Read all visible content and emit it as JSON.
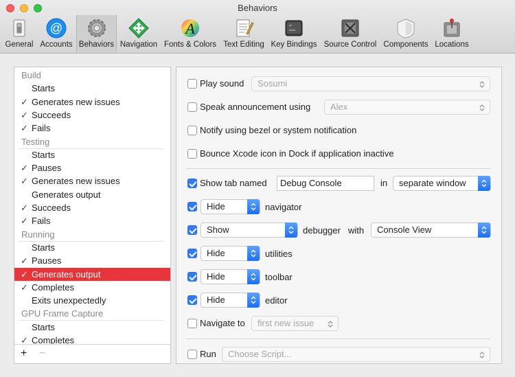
{
  "window": {
    "title": "Behaviors"
  },
  "toolbar": {
    "items": [
      {
        "label": "General",
        "icon": "general-icon"
      },
      {
        "label": "Accounts",
        "icon": "accounts-icon"
      },
      {
        "label": "Behaviors",
        "icon": "behaviors-gear-icon",
        "active": true
      },
      {
        "label": "Navigation",
        "icon": "navigation-icon"
      },
      {
        "label": "Fonts & Colors",
        "icon": "fonts-colors-icon"
      },
      {
        "label": "Text Editing",
        "icon": "text-editing-icon"
      },
      {
        "label": "Key Bindings",
        "icon": "key-bindings-icon"
      },
      {
        "label": "Source Control",
        "icon": "source-control-icon"
      },
      {
        "label": "Components",
        "icon": "components-icon"
      },
      {
        "label": "Locations",
        "icon": "locations-icon"
      }
    ]
  },
  "list": {
    "rows": [
      {
        "type": "header",
        "label": "Build"
      },
      {
        "type": "item",
        "label": "Starts",
        "checked": false
      },
      {
        "type": "item",
        "label": "Generates new issues",
        "checked": true
      },
      {
        "type": "item",
        "label": "Succeeds",
        "checked": true
      },
      {
        "type": "item",
        "label": "Fails",
        "checked": true
      },
      {
        "type": "header",
        "label": "Testing"
      },
      {
        "type": "item",
        "label": "Starts",
        "checked": false
      },
      {
        "type": "item",
        "label": "Pauses",
        "checked": true
      },
      {
        "type": "item",
        "label": "Generates new issues",
        "checked": true
      },
      {
        "type": "item",
        "label": "Generates output",
        "checked": false
      },
      {
        "type": "item",
        "label": "Succeeds",
        "checked": true
      },
      {
        "type": "item",
        "label": "Fails",
        "checked": true
      },
      {
        "type": "header",
        "label": "Running"
      },
      {
        "type": "item",
        "label": "Starts",
        "checked": false
      },
      {
        "type": "item",
        "label": "Pauses",
        "checked": true
      },
      {
        "type": "item",
        "label": "Generates output",
        "checked": true,
        "selected": true
      },
      {
        "type": "item",
        "label": "Completes",
        "checked": true
      },
      {
        "type": "item",
        "label": "Exits unexpectedly",
        "checked": false
      },
      {
        "type": "header",
        "label": "GPU Frame Capture"
      },
      {
        "type": "item",
        "label": "Starts",
        "checked": false
      },
      {
        "type": "item",
        "label": "Completes",
        "checked": true
      }
    ],
    "add_label": "+",
    "remove_label": "−"
  },
  "behavior": {
    "play_sound": {
      "label": "Play sound",
      "checked": false,
      "value": "Sosumi"
    },
    "speak": {
      "label": "Speak announcement using",
      "checked": false,
      "value": "Alex"
    },
    "notify": {
      "label": "Notify using bezel or system notification",
      "checked": false
    },
    "bounce": {
      "label": "Bounce Xcode icon in Dock if application inactive",
      "checked": false
    },
    "show_tab": {
      "label": "Show tab named",
      "checked": true,
      "name_value": "Debug Console",
      "in_label": "in",
      "where": "separate window"
    },
    "navigator": {
      "checked": true,
      "action": "Hide",
      "label": "navigator"
    },
    "debugger": {
      "checked": true,
      "action": "Show",
      "label": "debugger",
      "with_label": "with",
      "view": "Console View"
    },
    "utilities": {
      "checked": true,
      "action": "Hide",
      "label": "utilities"
    },
    "toolbar_row": {
      "checked": true,
      "action": "Hide",
      "label": "toolbar"
    },
    "editor": {
      "checked": true,
      "action": "Hide",
      "label": "editor"
    },
    "navigate_to": {
      "label": "Navigate to",
      "checked": false,
      "value": "first new issue"
    },
    "run": {
      "label": "Run",
      "checked": false,
      "value": "Choose Script..."
    }
  },
  "colors": {
    "selection": "#e8353a",
    "checkbox_on": "#2f7cf6"
  }
}
